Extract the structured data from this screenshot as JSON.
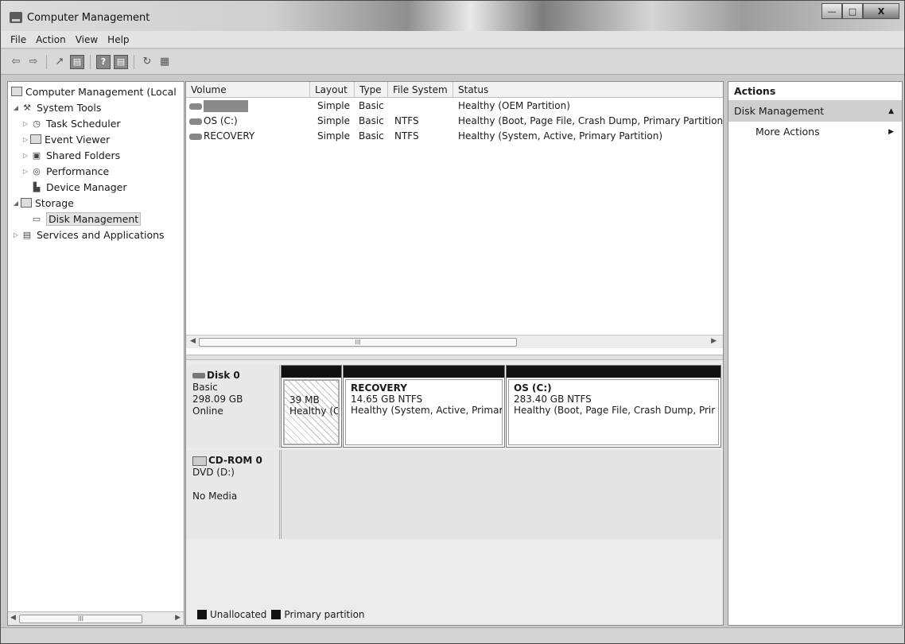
{
  "window": {
    "title": "Computer Management",
    "controls": {
      "minimize": "—",
      "maximize": "□",
      "close": "X"
    }
  },
  "menubar": [
    "File",
    "Action",
    "View",
    "Help"
  ],
  "toolbar": {
    "buttons": [
      "back-icon",
      "forward-icon",
      "up-icon",
      "show-hide-tree-icon",
      "help-icon",
      "show-hide-action-pane-icon",
      "refresh-icon",
      "properties-icon"
    ],
    "glyphs": {
      "back": "⇦",
      "forward": "⇨",
      "up": "↗",
      "tree": "▤",
      "help": "?",
      "action": "▤",
      "refresh": "↻",
      "props": "▦"
    }
  },
  "tree": {
    "root": "Computer Management (Local",
    "items": [
      {
        "label": "System Tools",
        "level": 1,
        "expanded": true
      },
      {
        "label": "Task Scheduler",
        "level": 2
      },
      {
        "label": "Event Viewer",
        "level": 2
      },
      {
        "label": "Shared Folders",
        "level": 2
      },
      {
        "label": "Performance",
        "level": 2
      },
      {
        "label": "Device Manager",
        "level": 2
      },
      {
        "label": "Storage",
        "level": 1,
        "expanded": true
      },
      {
        "label": "Disk Management",
        "level": 2,
        "selected": true
      },
      {
        "label": "Services and Applications",
        "level": 1
      }
    ],
    "scroll_glyph": "III"
  },
  "volumes": {
    "columns": [
      "Volume",
      "Layout",
      "Type",
      "File System",
      "Status"
    ],
    "rows": [
      {
        "volume": "",
        "layout": "Simple",
        "type": "Basic",
        "fs": "",
        "status": "Healthy (OEM Partition)"
      },
      {
        "volume": "OS (C:)",
        "layout": "Simple",
        "type": "Basic",
        "fs": "NTFS",
        "status": "Healthy (Boot, Page File, Crash Dump, Primary Partition"
      },
      {
        "volume": "RECOVERY",
        "layout": "Simple",
        "type": "Basic",
        "fs": "NTFS",
        "status": "Healthy (System, Active, Primary Partition)"
      }
    ],
    "scroll_glyph": "III"
  },
  "disks": [
    {
      "name": "Disk 0",
      "type": "Basic",
      "size": "298.09 GB",
      "state": "Online",
      "partitions": [
        {
          "name": "",
          "size": "39 MB",
          "status": "Healthy (C"
        },
        {
          "name": "RECOVERY",
          "size": "14.65 GB NTFS",
          "status": "Healthy (System, Active, Primar"
        },
        {
          "name": "OS  (C:)",
          "size": "283.40 GB NTFS",
          "status": "Healthy (Boot, Page File, Crash Dump, Prir"
        }
      ]
    }
  ],
  "cdrom": {
    "name": "CD-ROM 0",
    "drive": "DVD (D:)",
    "media": "No Media"
  },
  "legend": {
    "unallocated": "Unallocated",
    "primary": "Primary partition"
  },
  "actions": {
    "title": "Actions",
    "section": "Disk Management",
    "item": "More Actions"
  }
}
